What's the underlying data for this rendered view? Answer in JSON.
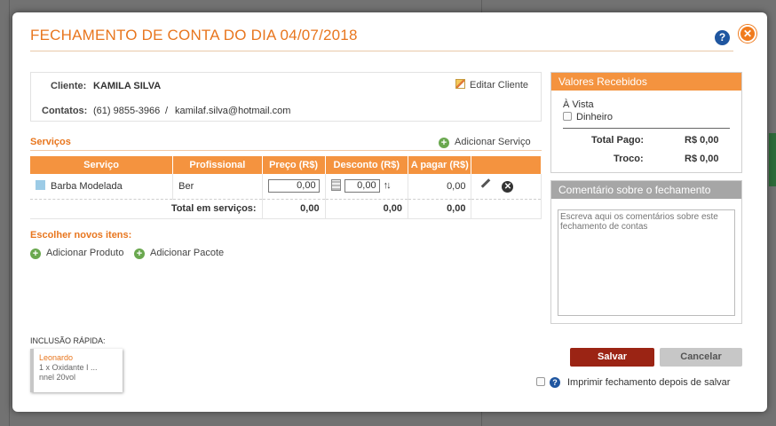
{
  "dialog": {
    "title": "FECHAMENTO DE CONTA DO DIA 04/07/2018"
  },
  "client": {
    "label": "Cliente:",
    "name": "KAMILA SILVA",
    "contacts_label": "Contatos:",
    "phone": "(61) 9855-3966",
    "separator": "/",
    "email": "kamilaf.silva@hotmail.com",
    "edit_label": "Editar Cliente"
  },
  "services": {
    "title": "Serviços",
    "add_label": "Adicionar Serviço",
    "columns": [
      "Serviço",
      "Profissional",
      "Preço (R$)",
      "Desconto (R$)",
      "A pagar (R$)",
      ""
    ],
    "rows": [
      {
        "service": "Barba Modelada",
        "professional": "Ber",
        "price": "0,00",
        "discount": "0,00",
        "to_pay": "0,00"
      }
    ],
    "total_label": "Total em serviços:",
    "total_price": "0,00",
    "total_discount": "0,00",
    "total_to_pay": "0,00"
  },
  "new_items": {
    "title": "Escolher novos itens:",
    "add_product": "Adicionar Produto",
    "add_package": "Adicionar Pacote"
  },
  "quick": {
    "label": "INCLUSÃO RÁPIDA:",
    "card": {
      "who": "Leonardo",
      "line1": "1 x Oxidante I ...",
      "line2": "nnel 20vol"
    }
  },
  "received": {
    "title": "Valores Recebidos",
    "cash_title": "À Vista",
    "cash_option": "Dinheiro",
    "total_paid_label": "Total Pago:",
    "total_paid": "R$ 0,00",
    "change_label": "Troco:",
    "change": "R$ 0,00"
  },
  "comment": {
    "title": "Comentário sobre o fechamento",
    "placeholder": "Escreva aqui os comentários sobre este fechamento de contas"
  },
  "actions": {
    "save": "Salvar",
    "cancel": "Cancelar",
    "print_label": "Imprimir fechamento depois de salvar"
  },
  "colors": {
    "accent": "#e8761e",
    "header_orange": "#f4933f",
    "save": "#9b2414"
  }
}
